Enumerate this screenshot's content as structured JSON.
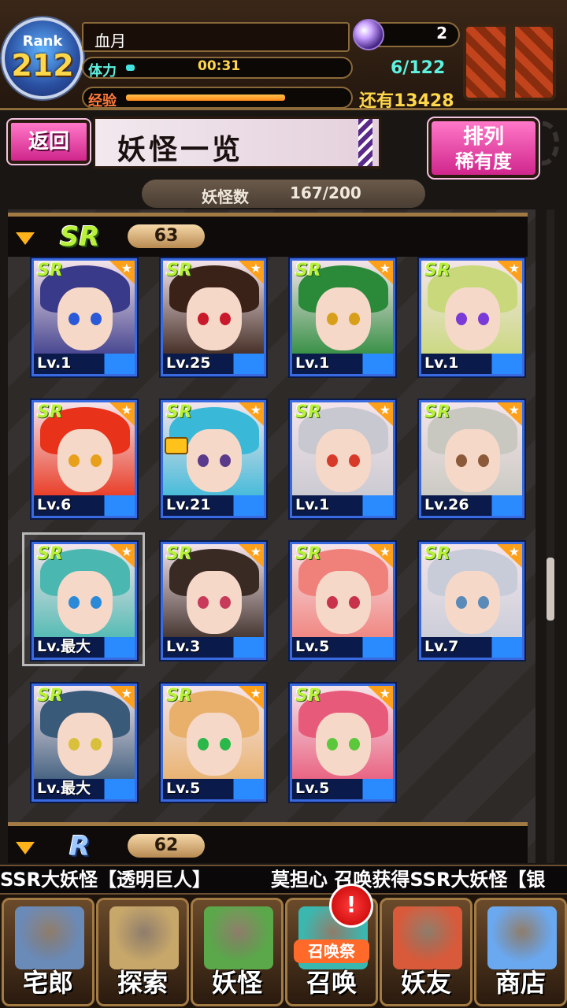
{
  "player": {
    "rank_label": "Rank",
    "rank": "212",
    "name": "血月"
  },
  "stamina": {
    "label": "体力",
    "timer": "00:31",
    "fill": 0.04
  },
  "exp": {
    "label": "经验",
    "fill": 0.72
  },
  "orbs": "2",
  "box": {
    "count": "6/122",
    "remaining": "还有13428"
  },
  "header": {
    "back_label": "返回",
    "title": "妖怪一览",
    "sort_line1": "排列",
    "sort_line2": "稀有度"
  },
  "yokai_count": {
    "label": "妖怪数",
    "value": "167/200"
  },
  "sections": [
    {
      "rarity": "SR",
      "count": "63"
    },
    {
      "rarity": "R",
      "count": "62"
    }
  ],
  "cards": [
    {
      "rarity": "SR",
      "level": "Lv.1",
      "hair": "#3a3a8a",
      "eye": "#2a5ad8"
    },
    {
      "rarity": "SR",
      "level": "Lv.25",
      "hair": "#3a2218",
      "eye": "#c81a2a"
    },
    {
      "rarity": "SR",
      "level": "Lv.1",
      "hair": "#2a8a3a",
      "eye": "#d8a01a"
    },
    {
      "rarity": "SR",
      "level": "Lv.1",
      "hair": "#c8d87a",
      "eye": "#7a3ad8"
    },
    {
      "rarity": "SR",
      "level": "Lv.6",
      "hair": "#e8321a",
      "eye": "#e8a01a"
    },
    {
      "rarity": "SR",
      "level": "Lv.21",
      "hair": "#3ab8d8",
      "eye": "#5a3a8a"
    },
    {
      "rarity": "SR",
      "level": "Lv.1",
      "hair": "#c8c8d0",
      "eye": "#d83a2a"
    },
    {
      "rarity": "SR",
      "level": "Lv.26",
      "hair": "#c8c8c0",
      "eye": "#8a5a3a"
    },
    {
      "rarity": "SR",
      "level": "Lv.最大",
      "hair": "#4ab8b0",
      "eye": "#2a8ad8"
    },
    {
      "rarity": "SR",
      "level": "Lv.3",
      "hair": "#3a2a24",
      "eye": "#c83a5a"
    },
    {
      "rarity": "SR",
      "level": "Lv.5",
      "hair": "#f0807a",
      "eye": "#c8324a"
    },
    {
      "rarity": "SR",
      "level": "Lv.7",
      "hair": "#c8ccd8",
      "eye": "#5a8ab8"
    },
    {
      "rarity": "SR",
      "level": "Lv.最大",
      "hair": "#3a5a7a",
      "eye": "#d8c03a"
    },
    {
      "rarity": "SR",
      "level": "Lv.5",
      "hair": "#e8b06a",
      "eye": "#2ab84a"
    },
    {
      "rarity": "SR",
      "level": "Lv.5",
      "hair": "#e85a7a",
      "eye": "#5ac83a"
    }
  ],
  "ticker": {
    "left": "SSR大妖怪【透明巨人】",
    "right": "莫担心 召唤获得SSR大妖怪【银"
  },
  "nav": [
    {
      "label": "宅郎",
      "color": "#6a8ab8"
    },
    {
      "label": "探索",
      "color": "#c8a86a"
    },
    {
      "label": "妖怪",
      "color": "#5aa84a"
    },
    {
      "label": "召唤",
      "color": "#3ab8b0",
      "banner": "召唤祭"
    },
    {
      "label": "妖友",
      "color": "#d85a3a"
    },
    {
      "label": "商店",
      "color": "#6aa8f0"
    }
  ],
  "alert": "!"
}
